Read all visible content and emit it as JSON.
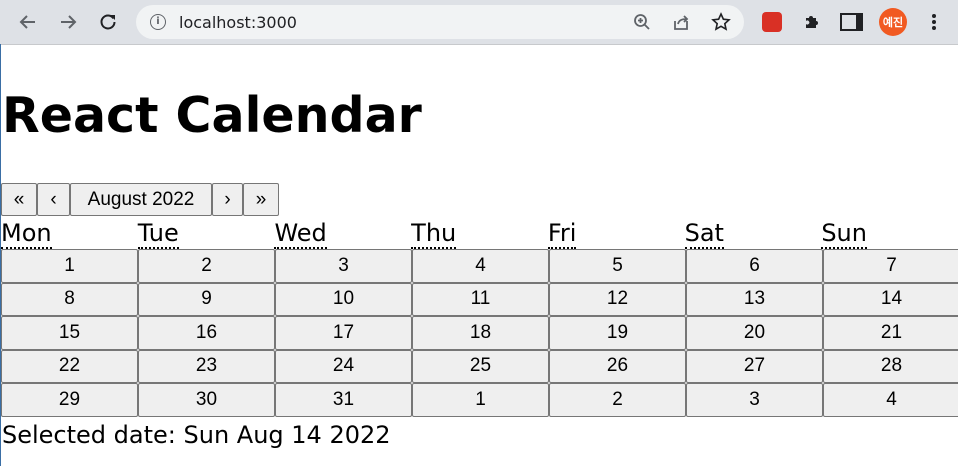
{
  "browser": {
    "url": "localhost:3000",
    "profile_initials": "예진",
    "icons": {
      "back": "arrow-left-icon",
      "forward": "arrow-right-icon",
      "reload": "reload-icon",
      "info": "info-icon",
      "zoom": "zoom-icon",
      "share": "share-icon",
      "bookmark": "star-icon",
      "extension": "extension-icon",
      "extensions_menu": "puzzle-icon",
      "side_panel": "side-panel-icon",
      "menu": "kebab-menu-icon"
    },
    "colors": {
      "toolbar": "#dee1e6",
      "omnibox": "#f1f3f4",
      "avatar": "#f15a22",
      "extension": "#d93025"
    }
  },
  "page": {
    "title": "React Calendar",
    "navigation": {
      "prev2_label": "«",
      "prev_label": "‹",
      "month_label": "August 2022",
      "next_label": "›",
      "next2_label": "»"
    },
    "weekdays": [
      "Mon",
      "Tue",
      "Wed",
      "Thu",
      "Fri",
      "Sat",
      "Sun"
    ],
    "days": [
      "1",
      "2",
      "3",
      "4",
      "5",
      "6",
      "7",
      "8",
      "9",
      "10",
      "11",
      "12",
      "13",
      "14",
      "15",
      "16",
      "17",
      "18",
      "19",
      "20",
      "21",
      "22",
      "23",
      "24",
      "25",
      "26",
      "27",
      "28",
      "29",
      "30",
      "31",
      "1",
      "2",
      "3",
      "4"
    ],
    "selected_text": "Selected date: Sun Aug 14 2022"
  }
}
